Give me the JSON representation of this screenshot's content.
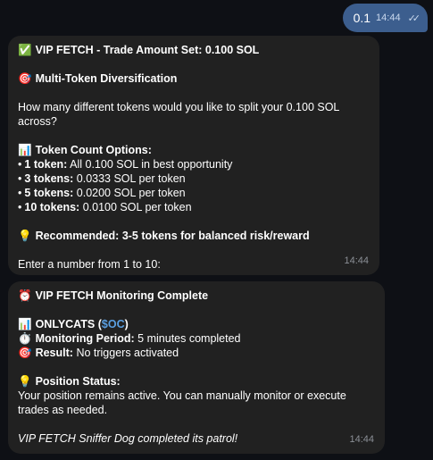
{
  "outgoing": {
    "text": "0.1",
    "time": "14:44",
    "ticks": "✓✓"
  },
  "message1": {
    "title_emoji": "✅",
    "title": "VIP FETCH - Trade Amount Set: 0.100 SOL",
    "section_emoji": "🎯",
    "section_title": "Multi-Token Diversification",
    "question_line1": "How many different tokens would you like to split your 0.100 SOL",
    "question_line2": "across?",
    "options_emoji": "📊",
    "options_title": "Token Count Options:",
    "options": [
      {
        "bullet": "•",
        "label": "1 token:",
        "text": "All 0.100 SOL in best opportunity"
      },
      {
        "bullet": "•",
        "label": "3 tokens:",
        "text": "0.0333 SOL per token"
      },
      {
        "bullet": "•",
        "label": "5 tokens:",
        "text": "0.0200 SOL per token"
      },
      {
        "bullet": "•",
        "label": "10 tokens:",
        "text": "0.0100 SOL per token"
      }
    ],
    "recommend_emoji": "💡",
    "recommend": "Recommended: 3-5 tokens for balanced risk/reward",
    "prompt": "Enter a number from 1 to 10:",
    "time": "14:44"
  },
  "message2": {
    "title_emoji": "⏰",
    "title": "VIP FETCH Monitoring Complete",
    "token_emoji": "📊",
    "token_name": "ONLYCATS",
    "token_open": "(",
    "token_ticker": "$OC",
    "token_close": ")",
    "period_emoji": "⏱️",
    "period_label": "Monitoring Period:",
    "period_value": "5 minutes completed",
    "result_emoji": "🎯",
    "result_label": "Result:",
    "result_value": "No triggers activated",
    "status_emoji": "💡",
    "status_title": "Position Status:",
    "status_line1": "Your position remains active. You can manually monitor or execute",
    "status_line2": "trades as needed.",
    "footer": "VIP FETCH Sniffer Dog completed its patrol!",
    "time": "14:44"
  }
}
